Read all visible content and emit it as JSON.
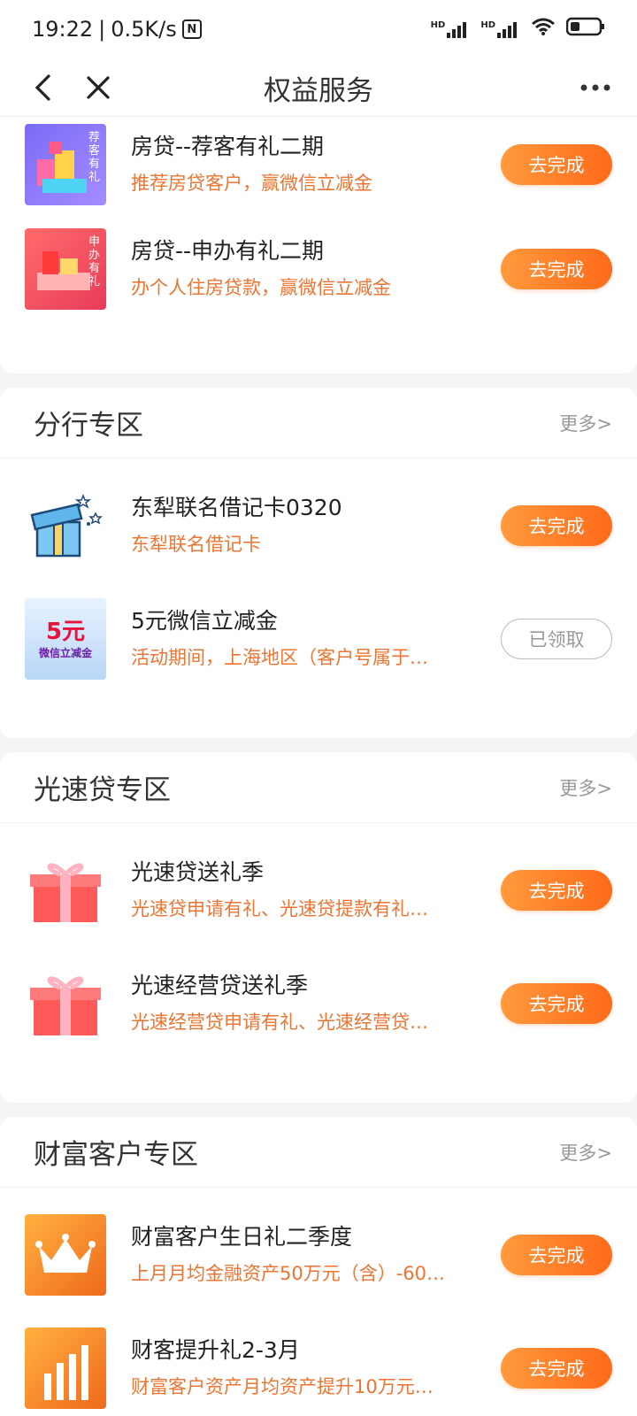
{
  "status_bar": {
    "time": "19:22",
    "speed": "0.5K/s",
    "nfc_label": "N",
    "hd1": "HD",
    "hd2": "HD"
  },
  "nav": {
    "title": "权益服务"
  },
  "top_items": [
    {
      "title": "房贷--荐客有礼二期",
      "desc": "推荐房贷客户，赢微信立减金",
      "button": "去完成",
      "thumb_text": "荐客有礼"
    },
    {
      "title": "房贷--申办有礼二期",
      "desc": "办个人住房贷款，赢微信立减金",
      "button": "去完成",
      "thumb_text": "申办有礼"
    }
  ],
  "sections": [
    {
      "title": "分行专区",
      "more": "更多>",
      "items": [
        {
          "title": "东犁联名借记卡0320",
          "desc": "东犁联名借记卡",
          "button": "去完成",
          "thumb": "gift-box"
        },
        {
          "title": "5元微信立减金",
          "desc": "活动期间，上海地区（客户号属于…",
          "button": "已领取",
          "thumb": "coupon",
          "thumb_big": "5元",
          "thumb_small": "微信立减金"
        }
      ]
    },
    {
      "title": "光速贷专区",
      "more": "更多>",
      "items": [
        {
          "title": "光速贷送礼季",
          "desc": "光速贷申请有礼、光速贷提款有礼…",
          "button": "去完成",
          "thumb": "red-gift"
        },
        {
          "title": "光速经营贷送礼季",
          "desc": "光速经营贷申请有礼、光速经营贷…",
          "button": "去完成",
          "thumb": "red-gift"
        }
      ]
    },
    {
      "title": "财富客户专区",
      "more": "更多>",
      "items": [
        {
          "title": "财富客户生日礼二季度",
          "desc": "上月月均金融资产50万元（含）-60…",
          "button": "去完成",
          "thumb": "crown"
        },
        {
          "title": "财客提升礼2-3月",
          "desc": "财富客户资产月均资产提升10万元…",
          "button": "去完成",
          "thumb": "bars"
        }
      ]
    }
  ],
  "colors": {
    "accent": "#ff6a1a",
    "desc_text": "#ee7431"
  }
}
